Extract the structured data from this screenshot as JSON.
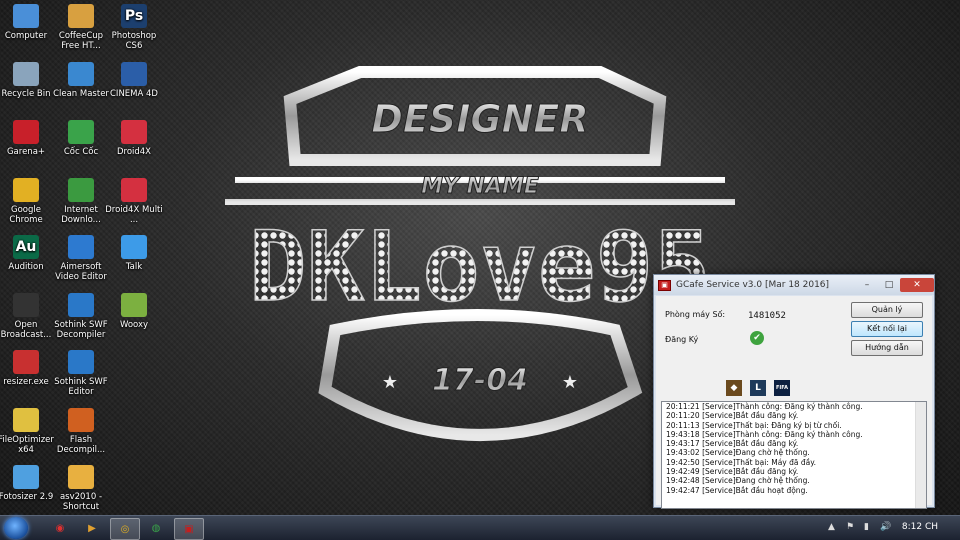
{
  "desktop_icons": [
    {
      "label": "Computer",
      "icon": "computer-icon",
      "color": "#4a8fd8"
    },
    {
      "label": "CoffeeCup Free HT...",
      "icon": "coffeecup-icon",
      "color": "#d8a040"
    },
    {
      "label": "Photoshop CS6",
      "icon": "photoshop-icon",
      "color": "#1c3f6e",
      "glyph": "Ps"
    },
    {
      "label": "Recycle Bin",
      "icon": "recycle-bin-icon",
      "color": "#8aa4bc"
    },
    {
      "label": "Clean Master",
      "icon": "clean-master-icon",
      "color": "#3a88d0"
    },
    {
      "label": "CINEMA 4D",
      "icon": "cinema4d-icon",
      "color": "#2b5ea8"
    },
    {
      "label": "Garena+",
      "icon": "garena-icon",
      "color": "#c8202a"
    },
    {
      "label": "Cốc Cốc",
      "icon": "coccoc-icon",
      "color": "#3aa34a"
    },
    {
      "label": "Droid4X",
      "icon": "droid4x-icon",
      "color": "#d43040"
    },
    {
      "label": "Google Chrome",
      "icon": "chrome-icon",
      "color": "#e2b023"
    },
    {
      "label": "Internet Downlo...",
      "icon": "idm-icon",
      "color": "#3b9a40"
    },
    {
      "label": "Droid4X Multi ...",
      "icon": "droid4x-multi-icon",
      "color": "#d43040"
    },
    {
      "label": "Audition",
      "icon": "audition-icon",
      "color": "#0b6a47",
      "glyph": "Au"
    },
    {
      "label": "Aimersoft Video Editor",
      "icon": "aimersoft-icon",
      "color": "#2d7ad0"
    },
    {
      "label": "Talk",
      "icon": "talk-icon",
      "color": "#3d9be8"
    },
    {
      "label": "Open Broadcast...",
      "icon": "obs-icon",
      "color": "#333333"
    },
    {
      "label": "Sothink SWF Decompiler",
      "icon": "sothink-icon",
      "color": "#2a78c8"
    },
    {
      "label": "Wooxy",
      "icon": "wooxy-icon",
      "color": "#7cb040"
    },
    {
      "label": "resizer.exe",
      "icon": "resizer-icon",
      "color": "#c83030"
    },
    {
      "label": "Sothink SWF Editor",
      "icon": "sothink-editor-icon",
      "color": "#2a78c8"
    },
    {
      "label": "FileOptimizer x64",
      "icon": "fileoptimizer-icon",
      "color": "#e0c040"
    },
    {
      "label": "Flash Decompil...",
      "icon": "flash-decompiler-icon",
      "color": "#d06020"
    },
    {
      "label": "Fotosizer 2.9",
      "icon": "fotosizer-icon",
      "color": "#4fa0e0"
    },
    {
      "label": "asv2010 - Shortcut",
      "icon": "asv2010-icon",
      "color": "#e8b040"
    }
  ],
  "logo": {
    "line1": "DESIGNER",
    "line2": "MY NAME",
    "line3": "DKLove95",
    "line4": "17-04",
    "star": "★"
  },
  "gcafe": {
    "title": "GCafe Service v3.0 [Mar 18 2016]",
    "min": "–",
    "max": "□",
    "close": "✕",
    "machine_label": "Phòng máy Số:",
    "machine_value": "1481052",
    "register_label": "Đăng Ký",
    "register_status": "✔",
    "buttons": {
      "manage": "Quản lý",
      "reconnect": "Kết nối lại",
      "guide": "Hướng dẫn"
    },
    "games": [
      {
        "icon": "game-1-icon",
        "glyph": "◆",
        "color": "#6b4a1e"
      },
      {
        "icon": "lol-icon",
        "glyph": "L",
        "color": "#1e3a5a"
      },
      {
        "icon": "fifa-icon",
        "glyph": "FIFA",
        "color": "#0c2040"
      }
    ],
    "log": [
      "20:11:21 [Service]Thành công: Đăng ký thành công.",
      "20:11:20 [Service]Bắt đầu đăng ký.",
      "20:11:13 [Service]Thất bại: Đăng ký bị từ chối.",
      "19:43:18 [Service]Thành công: Đăng ký thành công.",
      "19:43:17 [Service]Bắt đầu đăng ký.",
      "19:43:02 [Service]Đang chờ hệ thống.",
      "19:42:50 [Service]Thất bại: Máy đã đầy.",
      "19:42:49 [Service]Bắt đầu đăng ký.",
      "19:42:48 [Service]Đang chờ hệ thống.",
      "19:42:47 [Service]Bắt đầu hoạt động."
    ]
  },
  "taskbar": {
    "clock": "8:12 CH",
    "items": [
      {
        "icon": "pin-app-1-icon",
        "glyph": "◉",
        "color": "#e03030"
      },
      {
        "icon": "media-player-icon",
        "glyph": "▶",
        "color": "#e0a030"
      },
      {
        "icon": "chrome-taskbar-icon",
        "glyph": "◎",
        "color": "#e2b023"
      },
      {
        "icon": "coccoc-taskbar-icon",
        "glyph": "◍",
        "color": "#3aa34a"
      },
      {
        "icon": "gcafe-taskbar-icon",
        "glyph": "▣",
        "color": "#c41e1e"
      }
    ],
    "tray": [
      "▲",
      "⚑",
      "▮",
      "🔊"
    ]
  }
}
